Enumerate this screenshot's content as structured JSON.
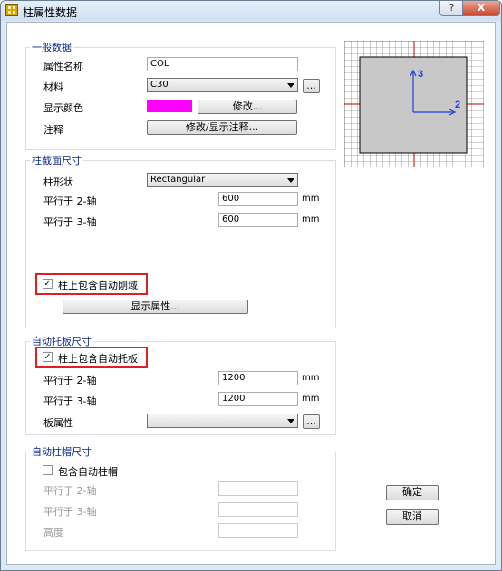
{
  "window": {
    "title": "柱属性数据",
    "help_label": "?",
    "close_label": "X"
  },
  "general": {
    "title": "一般数据",
    "name_label": "属性名称",
    "name_value": "COL",
    "material_label": "材料",
    "material_value": "C30",
    "material_browse": "...",
    "color_label": "显示颜色",
    "color_value": "#ff00ff",
    "color_button": "修改...",
    "note_label": "注释",
    "note_button": "修改/显示注释..."
  },
  "section": {
    "title": "柱截面尺寸",
    "shape_label": "柱形状",
    "shape_value": "Rectangular",
    "axis2_label": "平行于 2-轴",
    "axis2_value": "600",
    "axis2_unit": "mm",
    "axis3_label": "平行于 3-轴",
    "axis3_value": "600",
    "axis3_unit": "mm",
    "rigid_zone_label": "柱上包含自动刚域",
    "rigid_zone_checked": true,
    "show_props_button": "显示属性..."
  },
  "drop_panel": {
    "title": "自动托板尺寸",
    "include_label": "柱上包含自动托板",
    "include_checked": true,
    "axis2_label": "平行于 2-轴",
    "axis2_value": "1200",
    "axis2_unit": "mm",
    "axis3_label": "平行于 3-轴",
    "axis3_value": "1200",
    "axis3_unit": "mm",
    "slab_prop_label": "板属性",
    "slab_prop_value": "",
    "slab_browse": "..."
  },
  "capital": {
    "title": "自动柱帽尺寸",
    "include_label": "包含自动柱帽",
    "include_checked": false,
    "axis2_label": "平行于 2-轴",
    "axis3_label": "平行于 3-轴",
    "height_label": "高度"
  },
  "buttons": {
    "ok": "确定",
    "cancel": "取消"
  },
  "preview": {
    "axis2_label": "2",
    "axis3_label": "3"
  }
}
